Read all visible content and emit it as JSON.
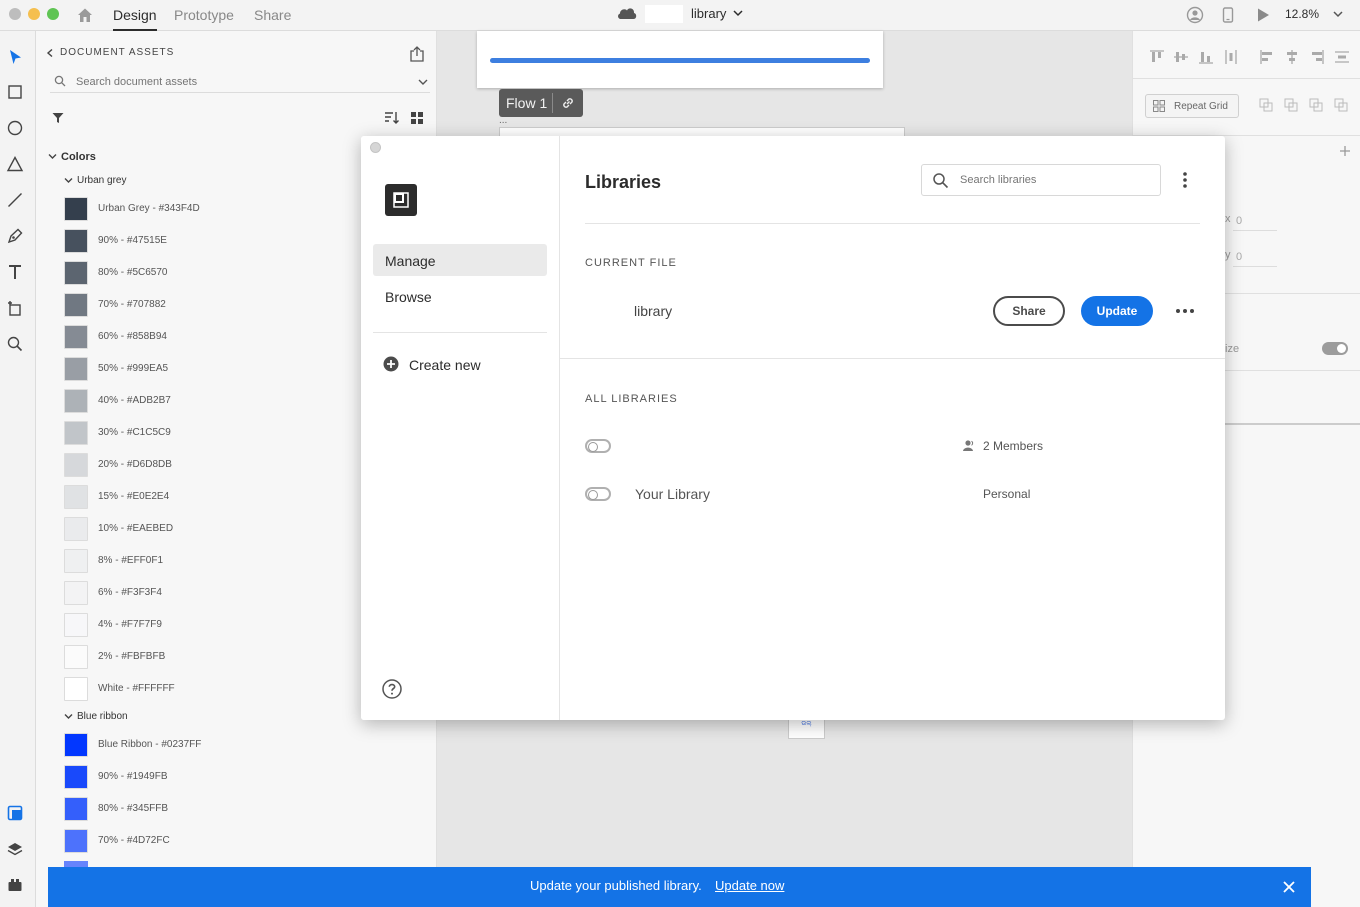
{
  "topbar": {
    "tabs": [
      "Design",
      "Prototype",
      "Share"
    ],
    "active_tab": "Design",
    "document_title": "library",
    "zoom": "12.8%",
    "icons": [
      "home-icon",
      "cloud-icon",
      "user-icon",
      "device-preview-icon",
      "play-icon"
    ]
  },
  "tools": [
    "select-tool-icon",
    "rectangle-tool-icon",
    "ellipse-tool-icon",
    "polygon-tool-icon",
    "line-tool-icon",
    "pen-tool-icon",
    "text-tool-icon",
    "artboard-tool-icon",
    "zoom-tool-icon",
    "assets-icon",
    "layers-icon",
    "plugins-icon"
  ],
  "assets": {
    "header": "DOCUMENT ASSETS",
    "search_placeholder": "Search document assets",
    "colors_label": "Colors",
    "groups": [
      {
        "name": "Urban grey",
        "colors": [
          {
            "label": "Urban Grey - #343F4D",
            "hex": "#343F4D"
          },
          {
            "label": "90% - #47515E",
            "hex": "#47515E"
          },
          {
            "label": "80% - #5C6570",
            "hex": "#5C6570"
          },
          {
            "label": "70% - #707882",
            "hex": "#707882"
          },
          {
            "label": "60% - #858B94",
            "hex": "#858B94"
          },
          {
            "label": "50% - #999EA5",
            "hex": "#999EA5"
          },
          {
            "label": "40% - #ADB2B7",
            "hex": "#ADB2B7"
          },
          {
            "label": "30% - #C1C5C9",
            "hex": "#C1C5C9"
          },
          {
            "label": "20% - #D6D8DB",
            "hex": "#D6D8DB"
          },
          {
            "label": "15% - #E0E2E4",
            "hex": "#E0E2E4"
          },
          {
            "label": "10% - #EAEBED",
            "hex": "#EAEBED"
          },
          {
            "label": "8% - #EFF0F1",
            "hex": "#EFF0F1"
          },
          {
            "label": "6% - #F3F3F4",
            "hex": "#F3F3F4"
          },
          {
            "label": "4% - #F7F7F9",
            "hex": "#F7F7F9"
          },
          {
            "label": "2% - #FBFBFB",
            "hex": "#FBFBFB"
          },
          {
            "label": "White - #FFFFFF",
            "hex": "#FFFFFF"
          }
        ]
      },
      {
        "name": "Blue ribbon",
        "colors": [
          {
            "label": "Blue Ribbon - #0237FF",
            "hex": "#0237FF"
          },
          {
            "label": "90% - #1949FB",
            "hex": "#1949FB"
          },
          {
            "label": "80% - #345FFB",
            "hex": "#345FFB"
          },
          {
            "label": "70% - #4D72FC",
            "hex": "#4D72FC"
          }
        ]
      }
    ]
  },
  "canvas": {
    "flow_label": "Flow 1",
    "progress": 1.0,
    "artboard_dots": "...",
    "thumb_text": "ଉଲ୍"
  },
  "props": {
    "repeat_grid_label": "Repeat Grid",
    "field_values": [
      "0",
      "0"
    ],
    "fragments": [
      "x",
      "y",
      "ize"
    ]
  },
  "libraries": {
    "title": "Libraries",
    "search_placeholder": "Search libraries",
    "nav": [
      "Manage",
      "Browse"
    ],
    "active_nav": "Manage",
    "create_new": "Create new",
    "current_file_heading": "CURRENT FILE",
    "current_file_name": "library",
    "share_label": "Share",
    "update_label": "Update",
    "all_libraries_heading": "ALL LIBRARIES",
    "rows": [
      {
        "name": "",
        "meta": "2 Members",
        "enabled": false
      },
      {
        "name": "Your Library",
        "meta": "Personal",
        "enabled": false
      }
    ]
  },
  "banner": {
    "message": "Update your published library.",
    "link": "Update now",
    "color": "#1473E6"
  }
}
